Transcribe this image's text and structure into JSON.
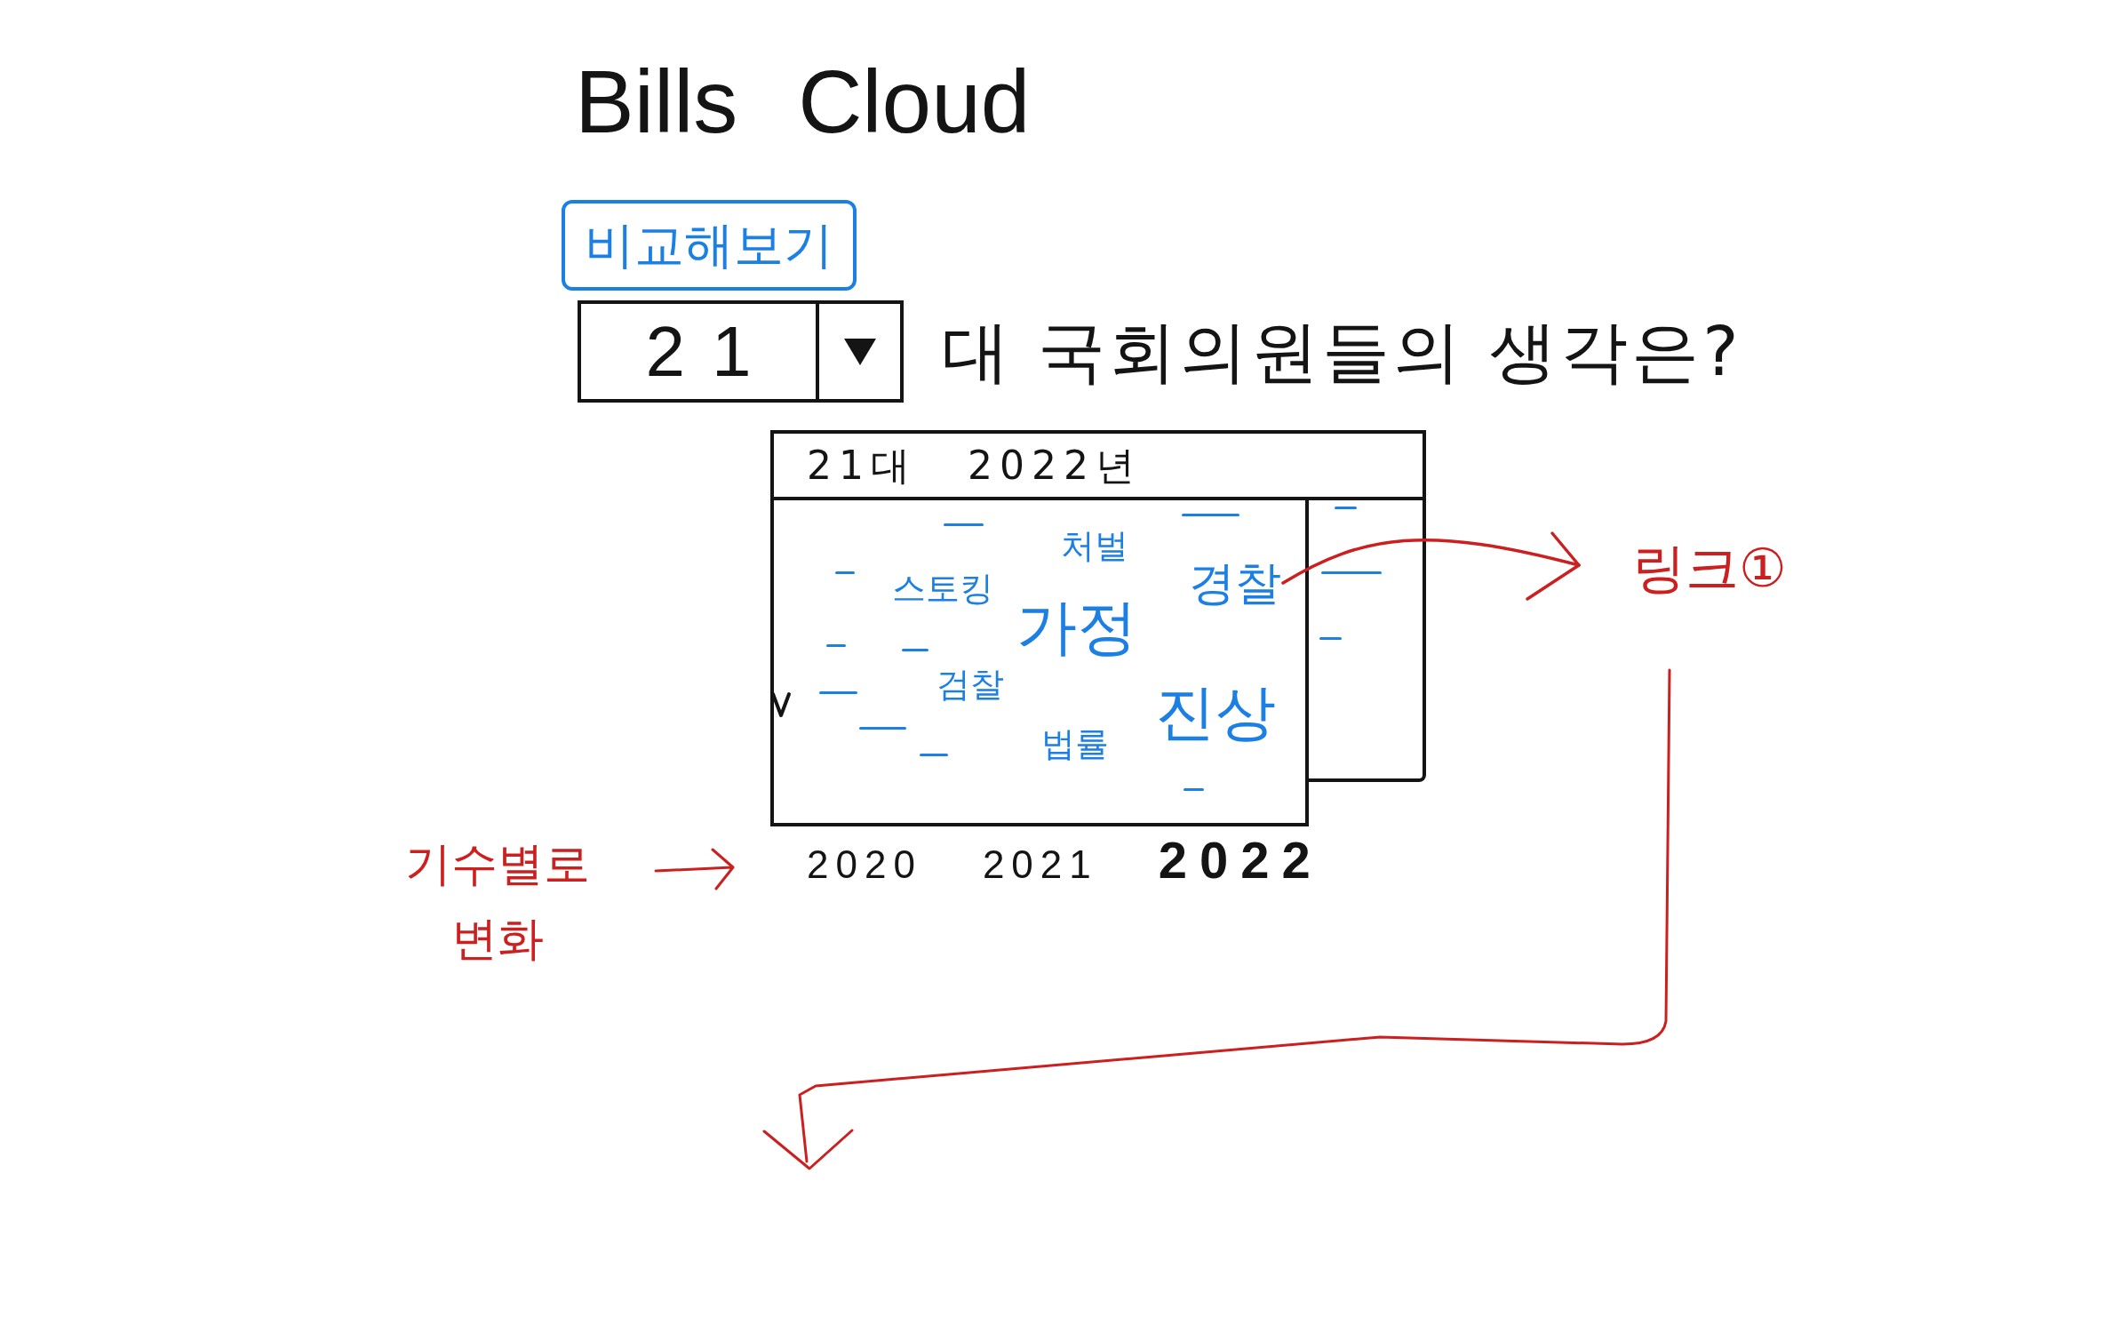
{
  "title": "Bills Cloud",
  "compare_button": {
    "label": "비교해보기"
  },
  "question": {
    "term_select": {
      "value": "21"
    },
    "text": "대 국회의원들의 생각은?"
  },
  "word_cloud": {
    "header": {
      "term": "21대",
      "year": "2022년"
    },
    "words": [
      {
        "text": "처벌",
        "kind": "small",
        "linked": false
      },
      {
        "text": "경찰",
        "kind": "medium",
        "linked": true
      },
      {
        "text": "스토킹",
        "kind": "small",
        "linked": false
      },
      {
        "text": "가정",
        "kind": "large",
        "linked": false
      },
      {
        "text": "검찰",
        "kind": "small",
        "linked": false
      },
      {
        "text": "진상",
        "kind": "large",
        "linked": false
      },
      {
        "text": "법률",
        "kind": "small",
        "linked": false
      }
    ]
  },
  "link_note": {
    "text": "링크①",
    "flow_arrow": true
  },
  "term_note": {
    "text": "기수별로 변화"
  },
  "years": [
    {
      "label": "2020",
      "selected": false
    },
    {
      "label": "2021",
      "selected": false
    },
    {
      "label": "2022",
      "selected": true
    }
  ]
}
